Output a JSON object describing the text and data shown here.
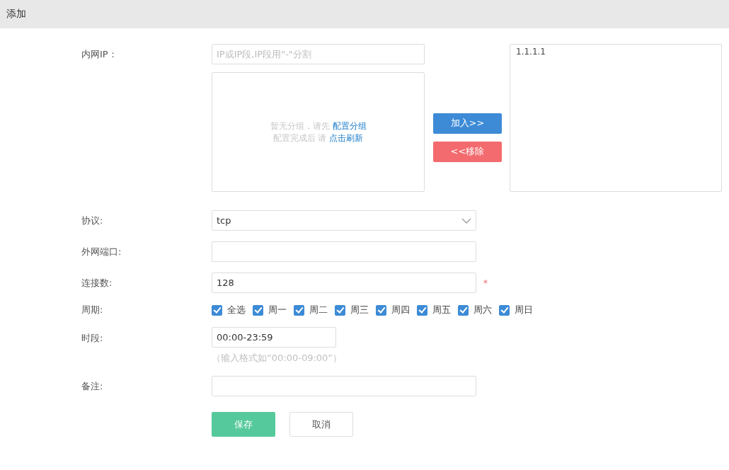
{
  "header": {
    "title": "添加"
  },
  "ip": {
    "label": "内网IP：",
    "placeholder": "IP或IP段,IP段用\"-\"分割",
    "group_message": [
      {
        "text": "暂无分组，请先",
        "link": "配置分组"
      },
      {
        "text": "配置完成后 请",
        "link": "点击刷新"
      }
    ],
    "add_button": "加入>>",
    "remove_button": "<<移除",
    "selected_items": [
      "1.1.1.1"
    ]
  },
  "protocol": {
    "label": "协议:",
    "value": "tcp"
  },
  "port": {
    "label": "外网端口:"
  },
  "connections": {
    "label": "连接数:",
    "value": "128",
    "required_mark": "*"
  },
  "period": {
    "label": "周期:",
    "options": [
      {
        "label": "全选",
        "checked": true
      },
      {
        "label": "周一",
        "checked": true
      },
      {
        "label": "周二",
        "checked": true
      },
      {
        "label": "周三",
        "checked": true
      },
      {
        "label": "周四",
        "checked": true
      },
      {
        "label": "周五",
        "checked": true
      },
      {
        "label": "周六",
        "checked": true
      },
      {
        "label": "周日",
        "checked": true
      }
    ]
  },
  "time_range": {
    "label": "时段:",
    "value": "00:00-23:59",
    "hint": "（输入格式如“00:00-09:00”）"
  },
  "note": {
    "label": "备注:"
  },
  "actions": {
    "save": "保存",
    "cancel": "取消"
  }
}
